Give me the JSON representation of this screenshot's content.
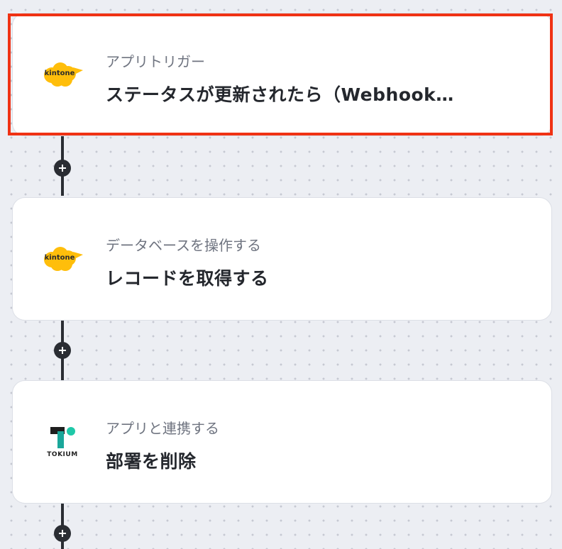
{
  "steps": [
    {
      "subtitle": "アプリトリガー",
      "title": "ステータスが更新されたら（Webhook…",
      "app": "kintone",
      "logo_text": "kintone",
      "highlighted": true
    },
    {
      "subtitle": "データベースを操作する",
      "title": "レコードを取得する",
      "app": "kintone",
      "logo_text": "kintone",
      "highlighted": false
    },
    {
      "subtitle": "アプリと連携する",
      "title": "部署を削除",
      "app": "TOKIUM",
      "logo_text": "TOKIUM",
      "highlighted": false
    }
  ],
  "colors": {
    "highlight": "#f03214",
    "connector": "#2a2d33",
    "kintone_yellow": "#ffbe0b",
    "tokium_teal": "#1aa79a"
  },
  "icons": {
    "add_step": "plus-icon"
  }
}
